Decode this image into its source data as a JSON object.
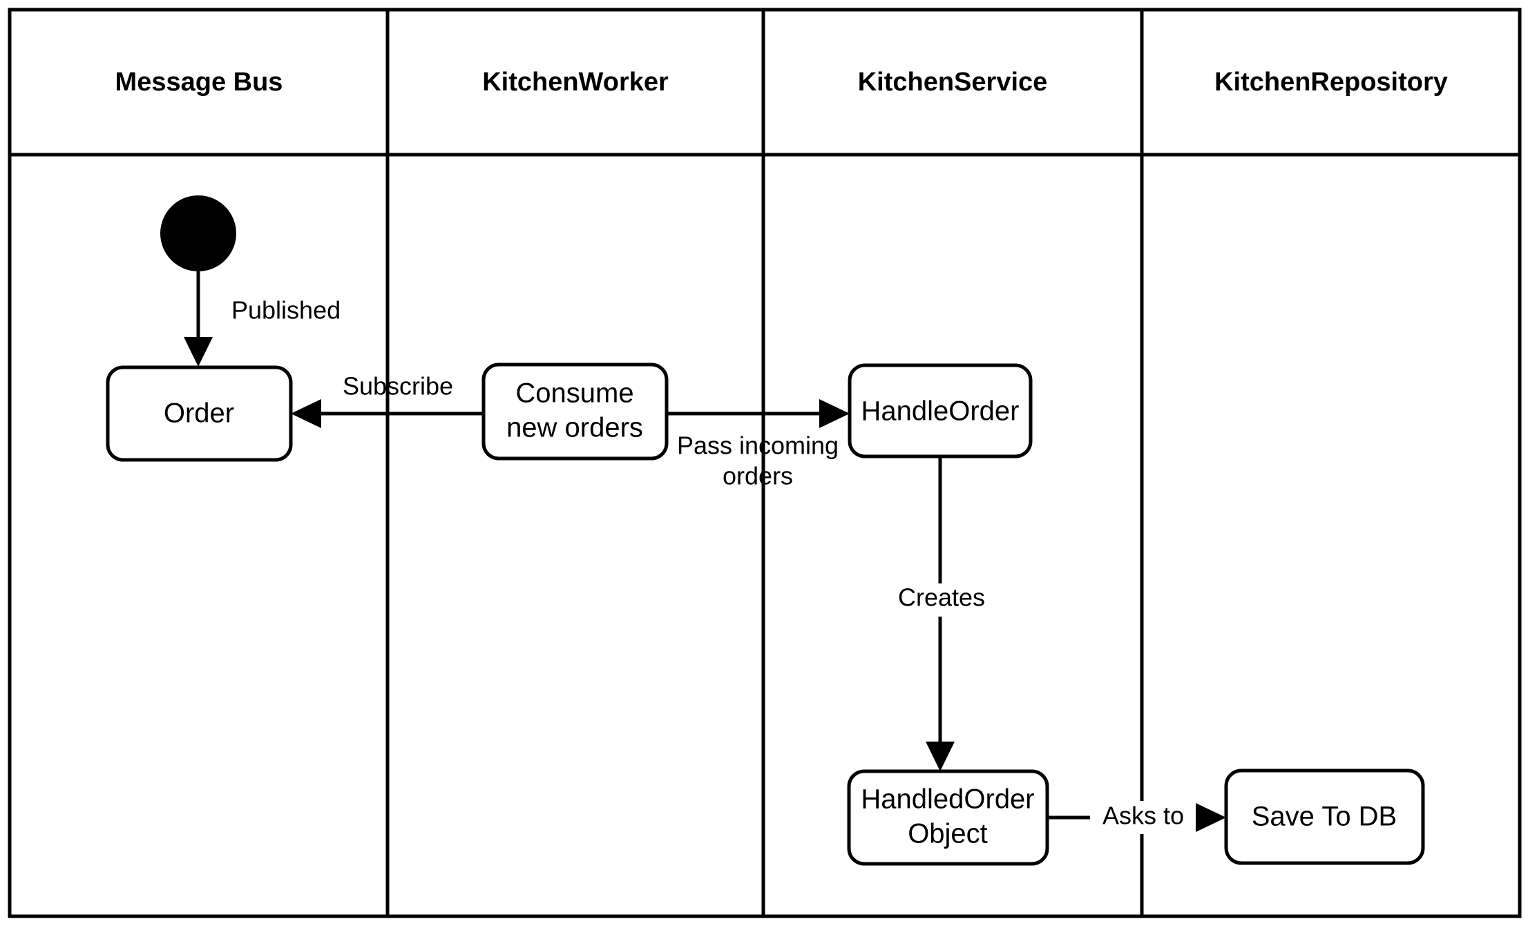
{
  "diagram": {
    "type": "uml-activity-swimlane",
    "lanes": [
      {
        "id": "message-bus",
        "title": "Message Bus"
      },
      {
        "id": "kitchen-worker",
        "title": "KitchenWorker"
      },
      {
        "id": "kitchen-service",
        "title": "KitchenService"
      },
      {
        "id": "kitchen-repository",
        "title": "KitchenRepository"
      }
    ],
    "nodes": [
      {
        "id": "start",
        "type": "initial-node",
        "lane": "message-bus",
        "label": ""
      },
      {
        "id": "order",
        "type": "activity",
        "lane": "message-bus",
        "label": "Order"
      },
      {
        "id": "consume",
        "type": "activity",
        "lane": "kitchen-worker",
        "line1": "Consume",
        "line2": "new orders"
      },
      {
        "id": "handle-order",
        "type": "activity",
        "lane": "kitchen-service",
        "label": "HandleOrder"
      },
      {
        "id": "handled-order-object",
        "type": "activity",
        "lane": "kitchen-service",
        "line1": "HandledOrder",
        "line2": "Object"
      },
      {
        "id": "save-to-db",
        "type": "activity",
        "lane": "kitchen-repository",
        "label": "Save To DB"
      }
    ],
    "edges": [
      {
        "id": "start-to-order",
        "from": "start",
        "to": "order",
        "label": "Published"
      },
      {
        "id": "consume-to-order",
        "from": "consume",
        "to": "order",
        "label": "Subscribe"
      },
      {
        "id": "consume-to-handle",
        "from": "consume",
        "to": "handle-order",
        "label_line1": "Pass incoming",
        "label_line2": "orders"
      },
      {
        "id": "handle-to-object",
        "from": "handle-order",
        "to": "handled-order-object",
        "label": "Creates"
      },
      {
        "id": "object-to-save",
        "from": "handled-order-object",
        "to": "save-to-db",
        "label": "Asks to"
      }
    ],
    "colors": {
      "stroke": "#000000",
      "fill": "#ffffff",
      "text": "#000000"
    }
  }
}
